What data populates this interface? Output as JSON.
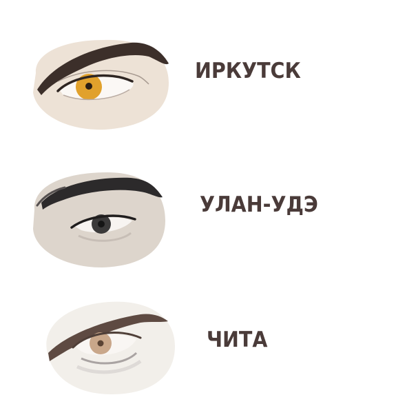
{
  "entries": [
    {
      "city": "ИРКУТСК",
      "iris_color": "#e1a12c",
      "skin_color": "#ede2d6",
      "brow_color": "#3c2f2a"
    },
    {
      "city": "УЛАН-УДЭ",
      "iris_color": "#3b3a3a",
      "skin_color": "#ddd5cc",
      "brow_color": "#2c2a2b"
    },
    {
      "city": "ЧИТА",
      "iris_color": "#c9a78a",
      "skin_color": "#f2efea",
      "brow_color": "#5e4a42"
    }
  ],
  "text_color": "#4a3b39"
}
